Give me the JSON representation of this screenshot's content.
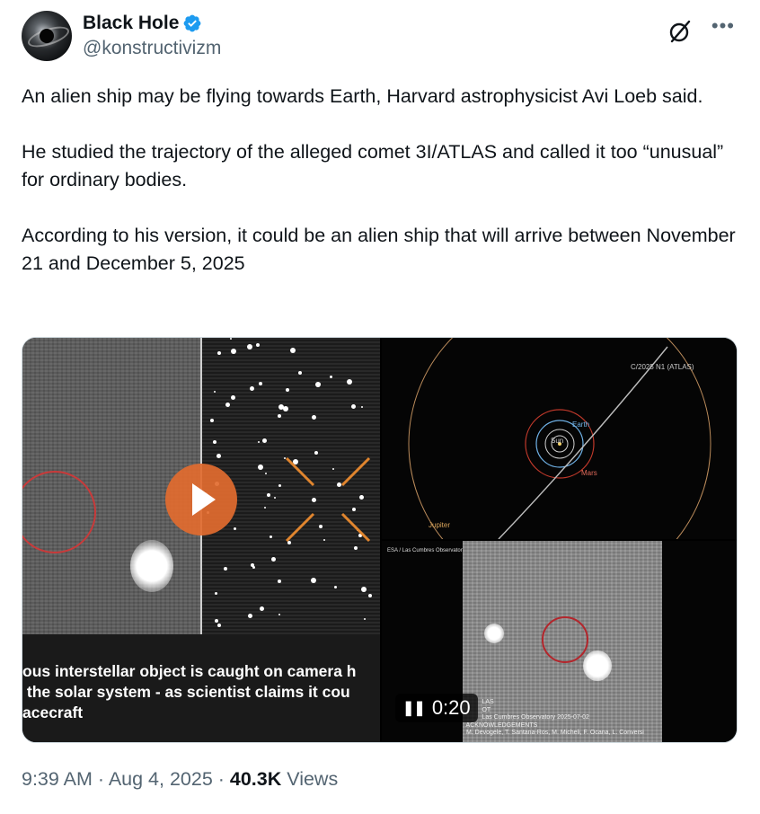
{
  "author": {
    "name": "Black Hole",
    "handle": "@konstructivizm",
    "verified_color": "#1d9bf0"
  },
  "tweet": {
    "text": "An alien ship may be flying towards Earth, Harvard astrophysicist Avi Loeb said.\n\nHe studied the trajectory of the alleged comet 3I/ATLAS and called it too “unusual” for ordinary bodies.\n\nAccording to his version, it could be an alien ship that will arrive between November 21 and December 5, 2025"
  },
  "media": {
    "video_caption": "ous interstellar object is caught on camera h\n the solar system - as scientist claims it cou\nacecraft",
    "video_time": "0:20",
    "orbit_diagram": {
      "comet_label": "C/2025 N1 (ATLAS)",
      "labels": [
        "Earth",
        "Sun",
        "Mars",
        "Jupiter"
      ]
    },
    "observatory_label": "ESA / Las Cumbres Observatory",
    "image_credits": "          LAS\n          OT\n          Las Cumbres Observatory 2025-07-02\n ACKNOWLEDGEMENTS\n M. Devogele, T. Santana-Ros, M. Micheli, F. Ocana, L. Conversi"
  },
  "meta": {
    "time": "9:39 AM",
    "separator": " · ",
    "date": "Aug 4, 2025",
    "views_count": "40.3K",
    "views_label": " Views"
  },
  "icons": {
    "grok": "slashed-circle-icon",
    "more": "more-horizontal-icon",
    "play": "play-icon",
    "pause": "pause-icon"
  }
}
